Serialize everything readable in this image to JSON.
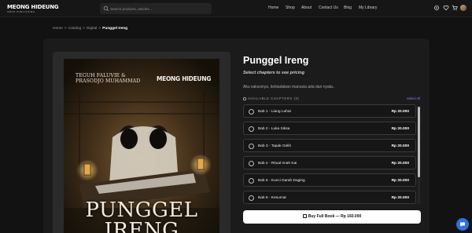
{
  "header": {
    "logo": "MEONG HIDEUNG",
    "logo_tag": "INDIE PUBLISHING",
    "search_placeholder": "Search products, articles...",
    "nav": [
      {
        "label": "Home"
      },
      {
        "label": "Shop"
      },
      {
        "label": "About"
      },
      {
        "label": "Contact Us"
      },
      {
        "label": "Blog"
      },
      {
        "label": "My Library"
      }
    ],
    "icons": [
      "settings-icon",
      "heart-icon",
      "cart-icon",
      "avatar"
    ]
  },
  "breadcrumb": {
    "items": [
      "Home",
      "Catalog",
      "Digital"
    ],
    "separator": ">",
    "current": "Punggel Ireng"
  },
  "cover": {
    "authors_line1": "TEGUH FALUVIE &",
    "authors_line2": "PRASODJO MUHAMMAD",
    "brand": "MEONG HIDEUNG",
    "title": "PUNGGEL IRENG"
  },
  "product": {
    "title": "Punggel Ireng",
    "subtitle": "Select chapters to see pricing",
    "description": "Aku sakssinya, kebiadaban manusia ada dan nyata..",
    "chapters_heading": "AVAILABLE CHAPTERS (8)",
    "select_all": "Select All",
    "chapters": [
      {
        "name": "Bab 1 - Liang Lahat",
        "price": "Rp 20.000"
      },
      {
        "name": "Bab 2 - Luka Siksa",
        "price": "Rp 20.000"
      },
      {
        "name": "Bab 3 - Tapak Gelih",
        "price": "Rp 20.000"
      },
      {
        "name": "Bab 4 - Ritual Imah Kai",
        "price": "Rp 20.000"
      },
      {
        "name": "Bab 5 - Kunci Darah Daging",
        "price": "Rp 20.000"
      },
      {
        "name": "Bab 6 - Kesumat",
        "price": "Rp 20.000"
      }
    ],
    "buy_label": "Buy Full Book — Rp 160.000"
  },
  "colors": {
    "background": "#121212",
    "panel": "#1b1b1b",
    "accent_link": "#7c84ff",
    "chat_button": "#2f6fe0"
  }
}
